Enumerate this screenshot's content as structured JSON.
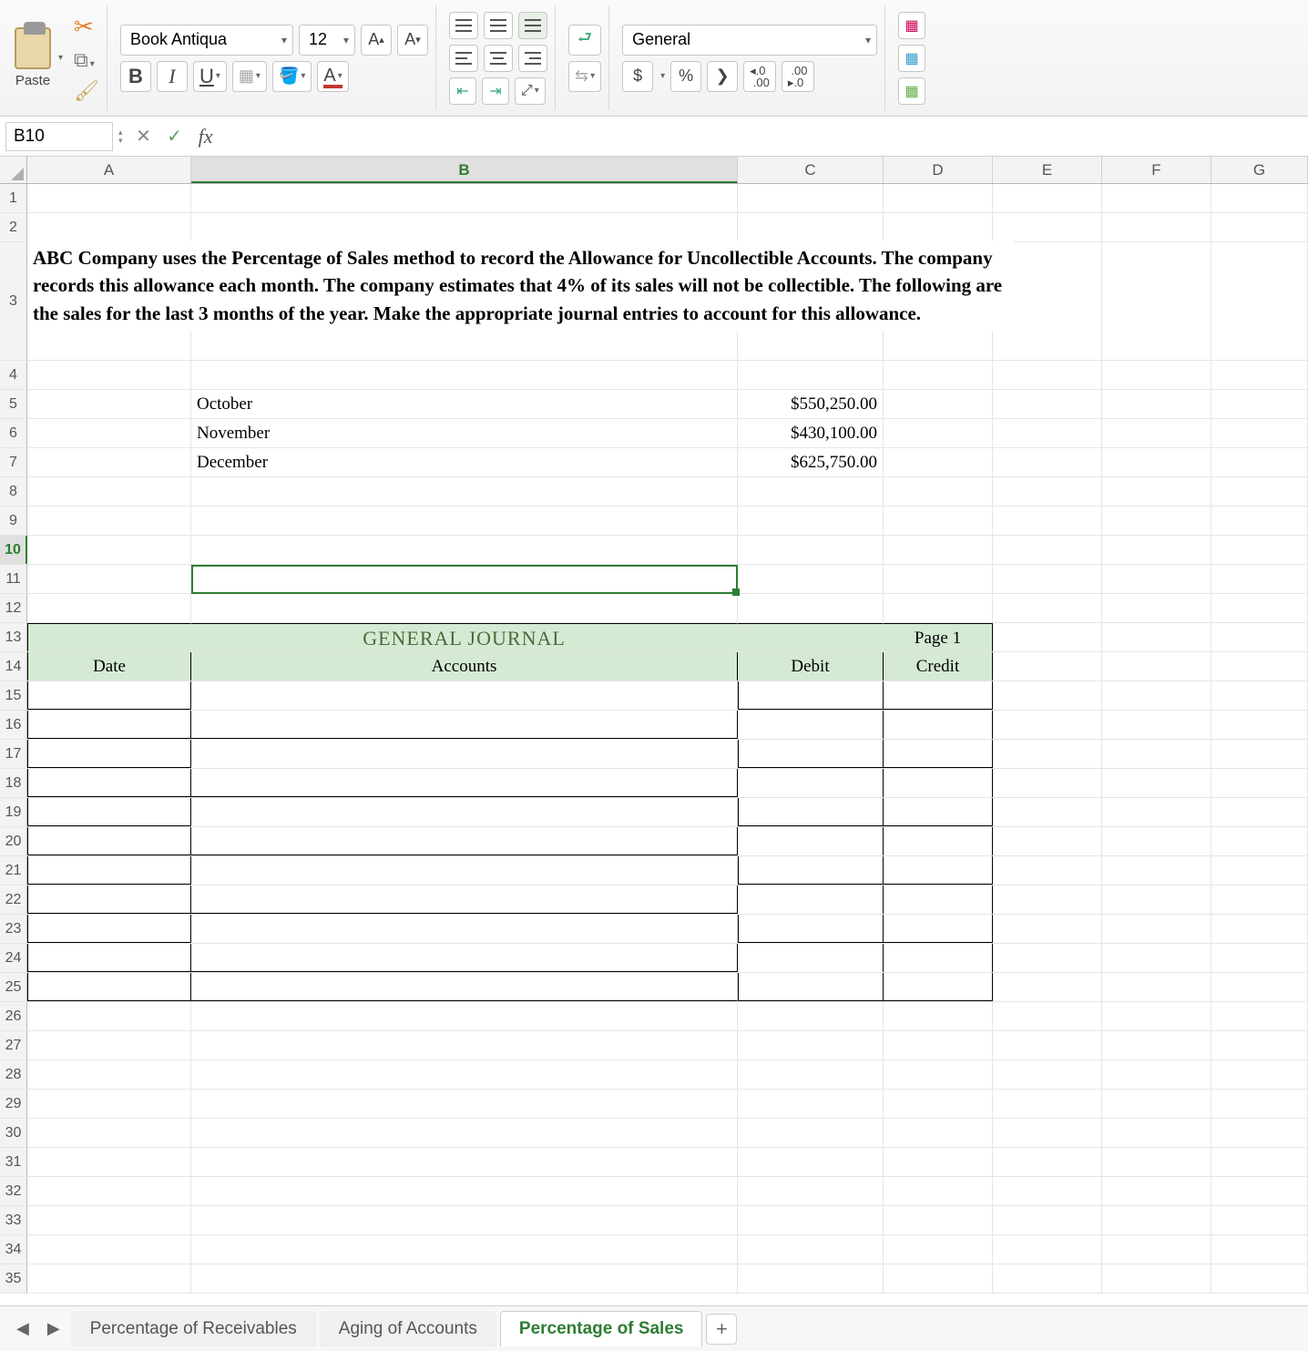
{
  "ribbon": {
    "paste_label": "Paste",
    "font_name": "Book Antiqua",
    "font_size": "12",
    "number_format": "General",
    "currency": "$",
    "percent": "%",
    "comma": "❯",
    "inc_dec": ".0\n.00",
    "dec_inc": ".00\n.0"
  },
  "formula": {
    "name_box": "B10",
    "fx_label": "fx",
    "value": ""
  },
  "columns": [
    "A",
    "B",
    "C",
    "D",
    "E",
    "F",
    "G"
  ],
  "active_cell": "B10",
  "problem_text": "ABC Company uses the Percentage of Sales method to record the Allowance for Uncollectible Accounts. The company records this allowance each month. The company estimates that 4% of its sales will not be collectible. The following are the sales for the last 3 months of the year. Make the appropriate journal entries to account for this allowance.",
  "sales": [
    {
      "month": "October",
      "amount": "$550,250.00"
    },
    {
      "month": "November",
      "amount": "$430,100.00"
    },
    {
      "month": "December",
      "amount": "$625,750.00"
    }
  ],
  "journal": {
    "title": "GENERAL JOURNAL",
    "page": "Page 1",
    "h_date": "Date",
    "h_accounts": "Accounts",
    "h_debit": "Debit",
    "h_credit": "Credit"
  },
  "tabs": {
    "t1": "Percentage of Receivables",
    "t2": "Aging of Accounts",
    "t3": "Percentage of Sales"
  }
}
